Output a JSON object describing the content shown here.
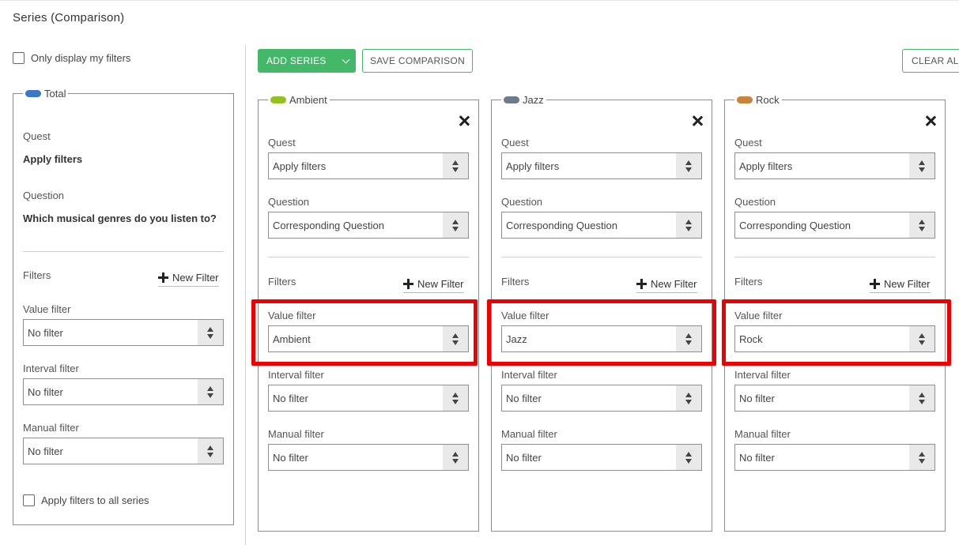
{
  "page": {
    "title": "Series (Comparison)"
  },
  "left": {
    "only_my_filters": "Only display my filters",
    "total": {
      "legend": "Total",
      "color": "#3a78c3",
      "quest_label": "Quest",
      "quest_value": "Apply filters",
      "question_label": "Question",
      "question_value": "Which musical genres do you listen to?",
      "filters_label": "Filters",
      "new_filter": "New Filter",
      "value_filter_label": "Value filter",
      "value_filter_value": "No filter",
      "interval_filter_label": "Interval filter",
      "interval_filter_value": "No filter",
      "manual_filter_label": "Manual filter",
      "manual_filter_value": "No filter",
      "apply_all": "Apply filters to all series"
    }
  },
  "toolbar": {
    "add_series": "ADD SERIES",
    "save_comparison": "SAVE COMPARISON",
    "clear_all": "CLEAR ALL"
  },
  "series": [
    {
      "legend": "Ambient",
      "color": "#94c11f",
      "quest_label": "Quest",
      "quest_value": "Apply filters",
      "question_label": "Question",
      "question_value": "Corresponding Question",
      "filters_label": "Filters",
      "new_filter": "New Filter",
      "value_filter_label": "Value filter",
      "value_filter_value": "Ambient",
      "interval_filter_label": "Interval filter",
      "interval_filter_value": "No filter",
      "manual_filter_label": "Manual filter",
      "manual_filter_value": "No filter"
    },
    {
      "legend": "Jazz",
      "color": "#6d7b8d",
      "quest_label": "Quest",
      "quest_value": "Apply filters",
      "question_label": "Question",
      "question_value": "Corresponding Question",
      "filters_label": "Filters",
      "new_filter": "New Filter",
      "value_filter_label": "Value filter",
      "value_filter_value": "Jazz",
      "interval_filter_label": "Interval filter",
      "interval_filter_value": "No filter",
      "manual_filter_label": "Manual filter",
      "manual_filter_value": "No filter"
    },
    {
      "legend": "Rock",
      "color": "#c8843a",
      "quest_label": "Quest",
      "quest_value": "Apply filters",
      "question_label": "Question",
      "question_value": "Corresponding Question",
      "filters_label": "Filters",
      "new_filter": "New Filter",
      "value_filter_label": "Value filter",
      "value_filter_value": "Rock",
      "interval_filter_label": "Interval filter",
      "interval_filter_value": "No filter",
      "manual_filter_label": "Manual filter",
      "manual_filter_value": "No filter"
    }
  ],
  "colors": {
    "accent_green": "#43b868",
    "highlight_red": "#ee0000"
  }
}
